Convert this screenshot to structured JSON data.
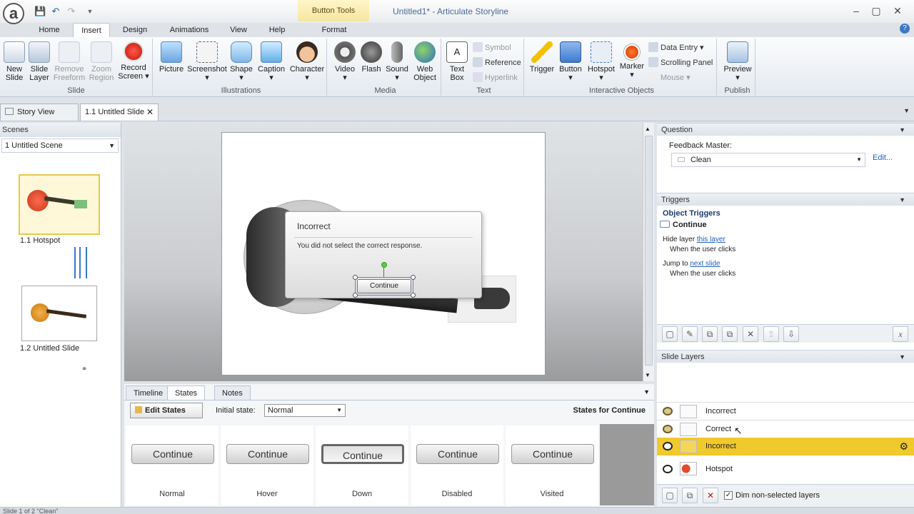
{
  "window": {
    "title": "Untitled1*",
    "app_name": "Articulate Storyline",
    "context_tab": "Button Tools"
  },
  "ribbon_tabs": [
    "Home",
    "Insert",
    "Design",
    "Animations",
    "View",
    "Help",
    "Format"
  ],
  "ribbon": {
    "slide_group": {
      "label": "Slide",
      "buttons": [
        "New Slide",
        "Slide Layer",
        "Remove Freeform",
        "Zoom Region",
        "Record Screen"
      ]
    },
    "illustrations_group": {
      "label": "Illustrations",
      "buttons": [
        "Picture",
        "Screenshot",
        "Shape",
        "Caption",
        "Character"
      ]
    },
    "media_group": {
      "label": "Media",
      "buttons": [
        "Video",
        "Flash",
        "Sound",
        "Web Object"
      ]
    },
    "text_group": {
      "label": "Text",
      "big": "Text Box",
      "small": [
        "Symbol",
        "Reference",
        "Hyperlink"
      ]
    },
    "interactive_group": {
      "label": "Interactive Objects",
      "buttons": [
        "Trigger",
        "Button",
        "Hotspot",
        "Marker"
      ],
      "small": [
        "Data Entry",
        "Scrolling Panel",
        "Mouse"
      ]
    },
    "publish_group": {
      "label": "Publish",
      "buttons": [
        "Preview"
      ]
    }
  },
  "doc_tabs": {
    "story_view": "Story View",
    "active": "1.1 Untitled Slide"
  },
  "scenes": {
    "header": "Scenes",
    "selected_scene": "1 Untitled Scene",
    "slides": [
      "1.1 Hotspot",
      "1.2 Untitled Slide"
    ]
  },
  "slide_content": {
    "feedback_title": "Incorrect",
    "feedback_body": "You did not select the correct response.",
    "button_label": "Continue"
  },
  "bottom_tabs": [
    "Timeline",
    "States",
    "Notes"
  ],
  "states_panel": {
    "edit_states": "Edit States",
    "initial_state_label": "Initial state:",
    "initial_state_value": "Normal",
    "states_for": "States for Continue",
    "states": [
      {
        "name": "Normal",
        "label": "Continue"
      },
      {
        "name": "Hover",
        "label": "Continue"
      },
      {
        "name": "Down",
        "label": "Continue"
      },
      {
        "name": "Disabled",
        "label": "Continue"
      },
      {
        "name": "Visited",
        "label": "Continue"
      }
    ]
  },
  "question_panel": {
    "header": "Question",
    "feedback_master_label": "Feedback Master:",
    "feedback_master_value": "Clean",
    "edit_link": "Edit..."
  },
  "triggers_panel": {
    "header": "Triggers",
    "section": "Object Triggers",
    "object": "Continue",
    "triggers": [
      {
        "action": "Hide layer",
        "target": "this layer",
        "when": "When the user clicks"
      },
      {
        "action": "Jump to",
        "target": "next slide",
        "when": "When the user clicks"
      }
    ]
  },
  "layers_panel": {
    "header": "Slide Layers",
    "layers": [
      "Incorrect",
      "Correct",
      "Incorrect",
      "Hotspot"
    ],
    "dim_label": "Dim non-selected layers"
  },
  "status": {
    "text": "Slide 1 of 2    \"Clean\""
  }
}
